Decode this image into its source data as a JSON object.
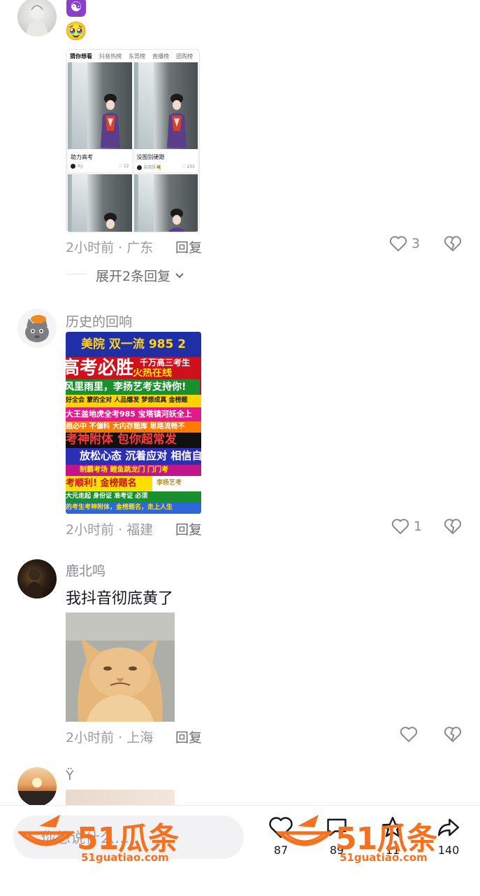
{
  "comments": [
    {
      "username": "",
      "emoji_a": "☯",
      "emoji_b": "🥹",
      "screenshot": {
        "tabs": [
          "猜你想看",
          "抖音热榜",
          "东莞榜",
          "直播榜",
          "团购榜"
        ],
        "cards": [
          {
            "title": "助力高考",
            "author": "Xy",
            "likes": "12"
          },
          {
            "title": "没图别硬跟",
            "author": "自我拆💐",
            "likes": "255"
          }
        ]
      },
      "time_location": "2小时前 · 广东",
      "reply_label": "回复",
      "like_count": "3",
      "expand_label": "展开2条回复"
    },
    {
      "username": "历史的回响",
      "poster_lines": [
        "美院 双一流 985 2",
        "高考必胜",
        "千万高三考生",
        "火热在线",
        "风里雨里，李扬艺考支持你!",
        "好全会 蒙的全对 人品爆发 梦想成真 金榜题",
        "大王盖地虎全考985 宝塔镇河妖全上",
        "题必中 不偏科 大内存题库 思路流畅不",
        "考神附体 包你超常发",
        "放松心态 沉着应对 相信自",
        "制霸考场 鲤鱼跳龙门 门门考",
        "考顺利! 金榜题名",
        "李扬艺考",
        "大元走起 身份证 准考证 必须",
        "的考生考神附体，金榜题名，走上人生"
      ],
      "time_location": "2小时前 · 福建",
      "reply_label": "回复",
      "like_count": "1"
    },
    {
      "username": "鹿北鸣",
      "text": "我抖音彻底黄了",
      "time_location": "2小时前 · 上海",
      "reply_label": "回复",
      "like_count": ""
    },
    {
      "username": "Ÿ"
    }
  ],
  "bottom_bar": {
    "input_placeholder": "你想说什么…",
    "counts": [
      "87",
      "89",
      "11",
      "140"
    ]
  },
  "watermark": {
    "brand": "51瓜条",
    "url": "51guatiao.com"
  },
  "colors": {
    "accent": "#f5711f",
    "meta_gray": "#9a9ba0",
    "text": "#161823"
  }
}
